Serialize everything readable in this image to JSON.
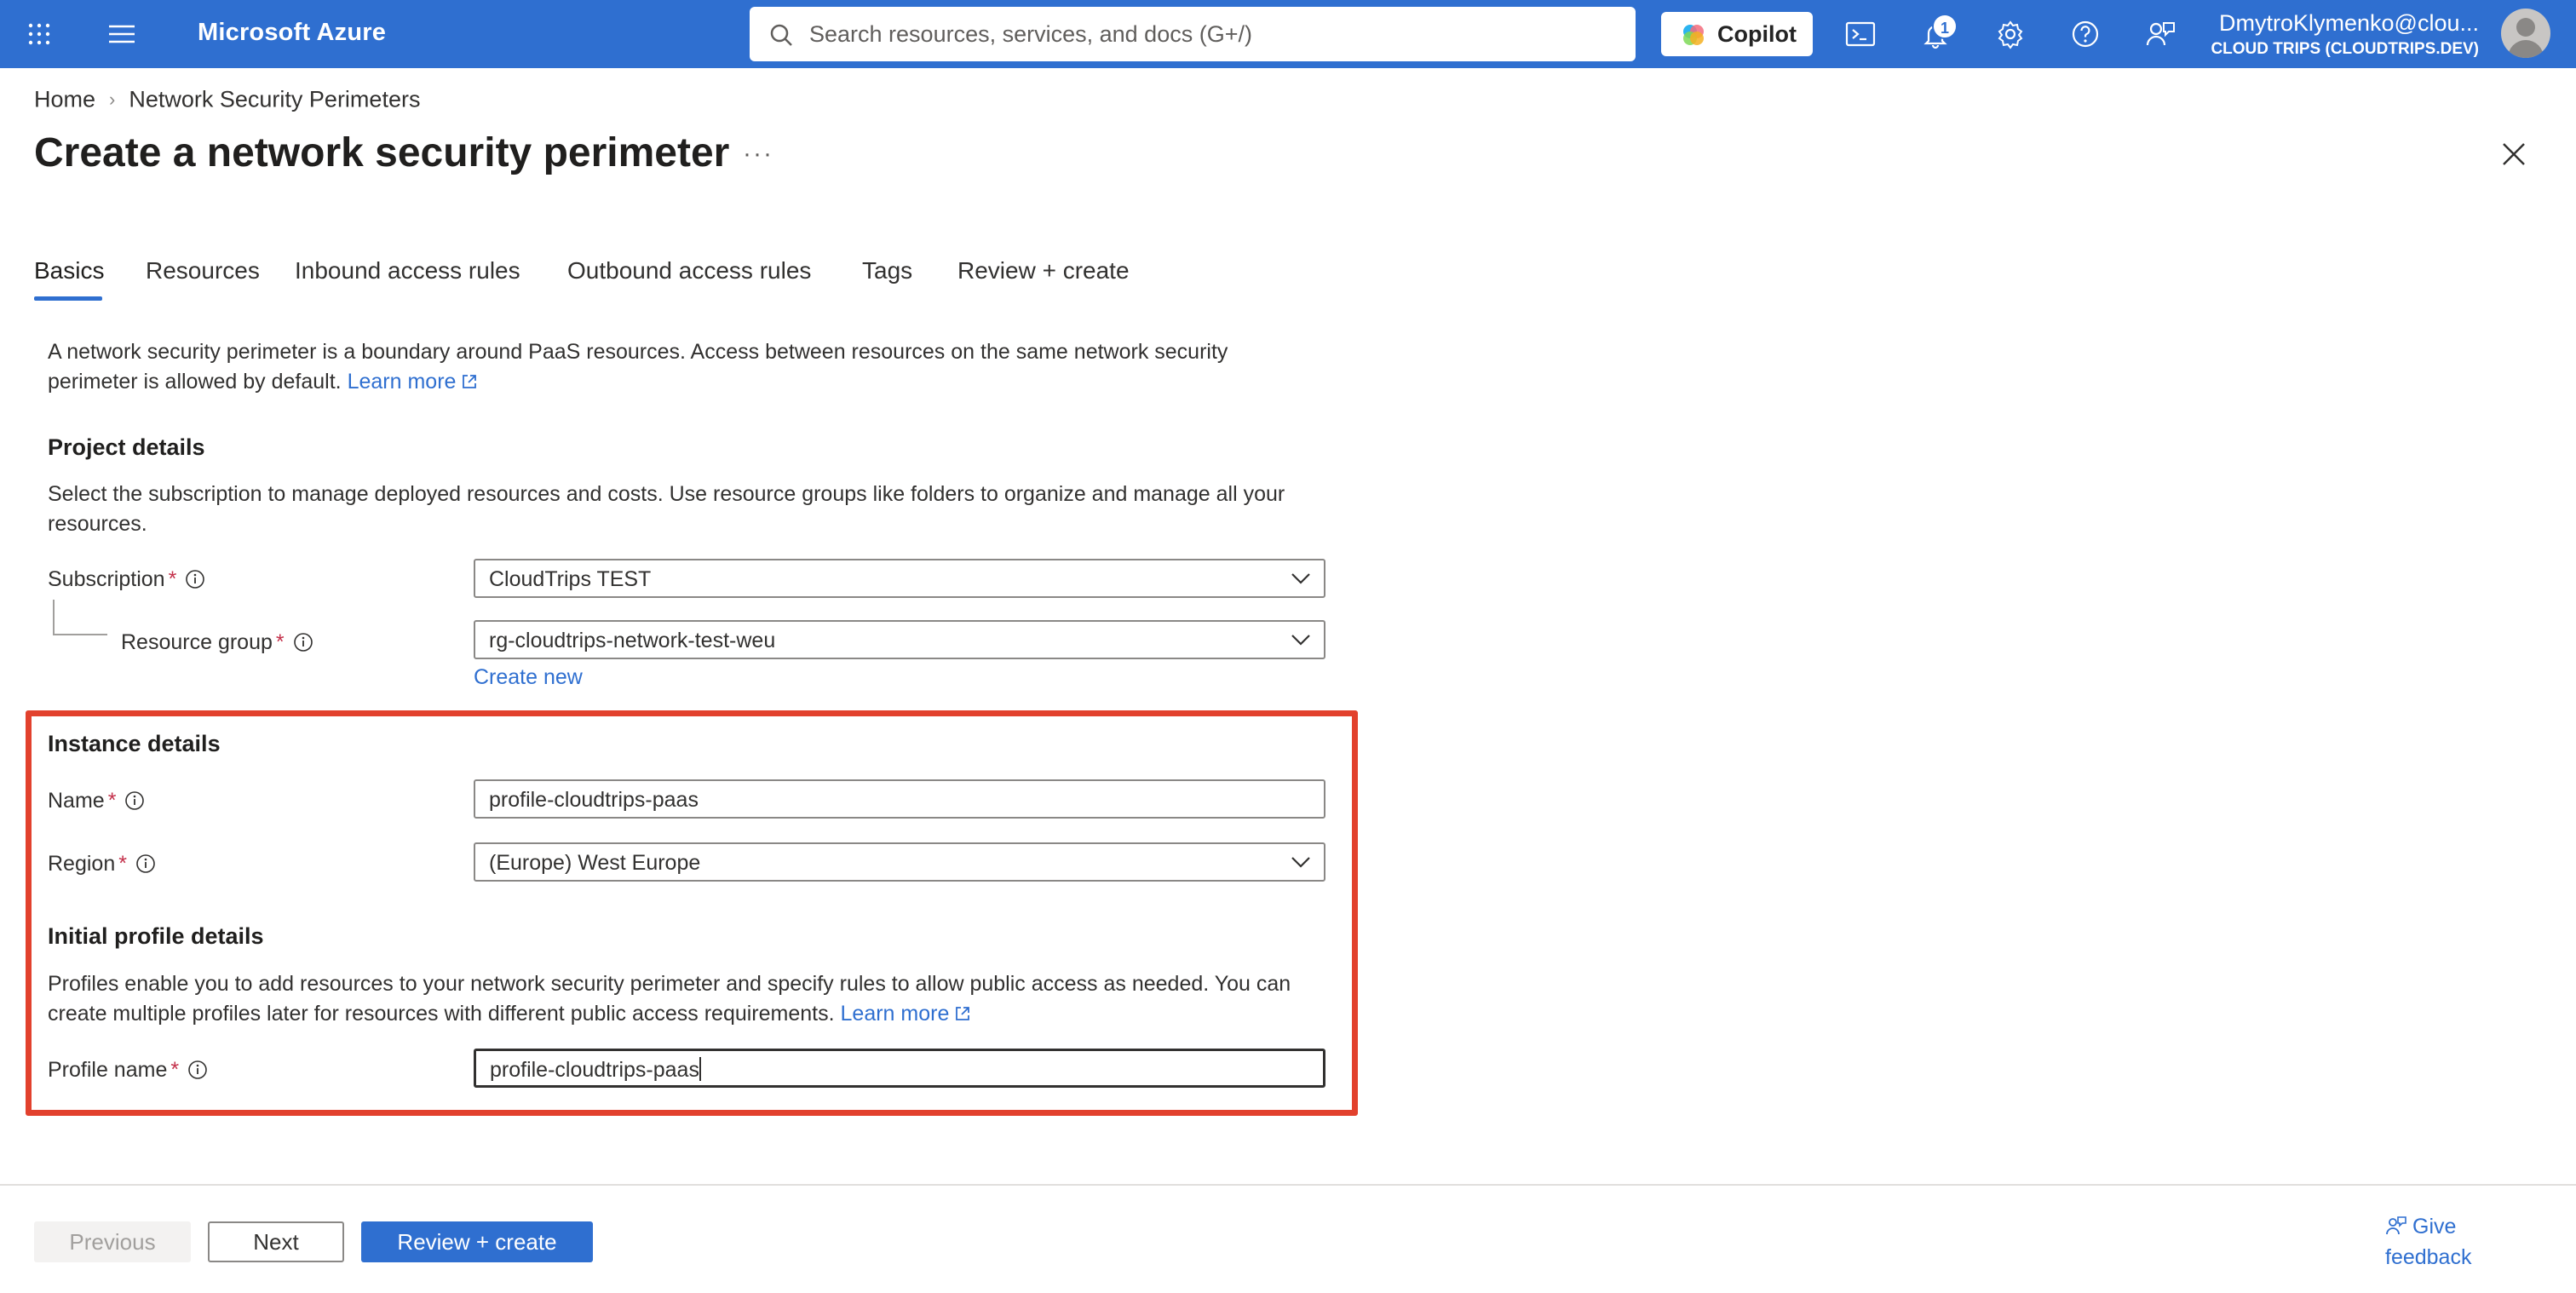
{
  "topbar": {
    "brand": "Microsoft Azure",
    "search_placeholder": "Search resources, services, and docs (G+/)",
    "copilot_label": "Copilot",
    "notification_count": "1",
    "user_name": "DmytroKlymenko@clou...",
    "user_tenant": "CLOUD TRIPS (CLOUDTRIPS.DEV)",
    "icons": [
      "waffle-icon",
      "hamburger-menu-icon",
      "search-icon",
      "copilot-icon",
      "cloud-shell-icon",
      "bell-icon",
      "gear-icon",
      "help-icon",
      "feedback-icon",
      "avatar-icon"
    ]
  },
  "breadcrumb": {
    "home": "Home",
    "current": "Network Security Perimeters"
  },
  "page": {
    "title": "Create a network security perimeter",
    "more": "···"
  },
  "tabs": [
    {
      "label": "Basics",
      "active": true
    },
    {
      "label": "Resources",
      "active": false
    },
    {
      "label": "Inbound access rules",
      "active": false
    },
    {
      "label": "Outbound access rules",
      "active": false
    },
    {
      "label": "Tags",
      "active": false
    },
    {
      "label": "Review + create",
      "active": false
    }
  ],
  "intro": {
    "text_line1": "A network security perimeter is a boundary around PaaS resources. Access between resources on the same network security",
    "text_line2": "perimeter is allowed by default.",
    "learn_more": "Learn more"
  },
  "project_details": {
    "heading": "Project details",
    "desc_line1": "Select the subscription to manage deployed resources and costs. Use resource groups like folders to organize and manage all your",
    "desc_line2": "resources.",
    "subscription_label": "Subscription",
    "subscription_value": "CloudTrips TEST",
    "resource_group_label": "Resource group",
    "resource_group_value": "rg-cloudtrips-network-test-weu",
    "create_new": "Create new",
    "required_marker": "*"
  },
  "instance_details": {
    "heading": "Instance details",
    "name_label": "Name",
    "name_value": "profile-cloudtrips-paas",
    "region_label": "Region",
    "region_value": "(Europe) West Europe"
  },
  "profile_details": {
    "heading": "Initial profile details",
    "desc_line1": "Profiles enable you to add resources to your network security perimeter and specify rules to allow public access as needed. You can",
    "desc_line2": "create multiple profiles later for resources with different public access requirements.",
    "learn_more": "Learn more",
    "profile_name_label": "Profile name",
    "profile_name_value": "profile-cloudtrips-paas"
  },
  "footer": {
    "previous": "Previous",
    "next": "Next",
    "review_create": "Review + create",
    "feedback_line1": "Give",
    "feedback_line2": "feedback"
  },
  "colors": {
    "topbar": "#2f6fd0",
    "accent": "#2f6fd0",
    "required": "#c4314b",
    "highlight_box": "#e2412d"
  }
}
